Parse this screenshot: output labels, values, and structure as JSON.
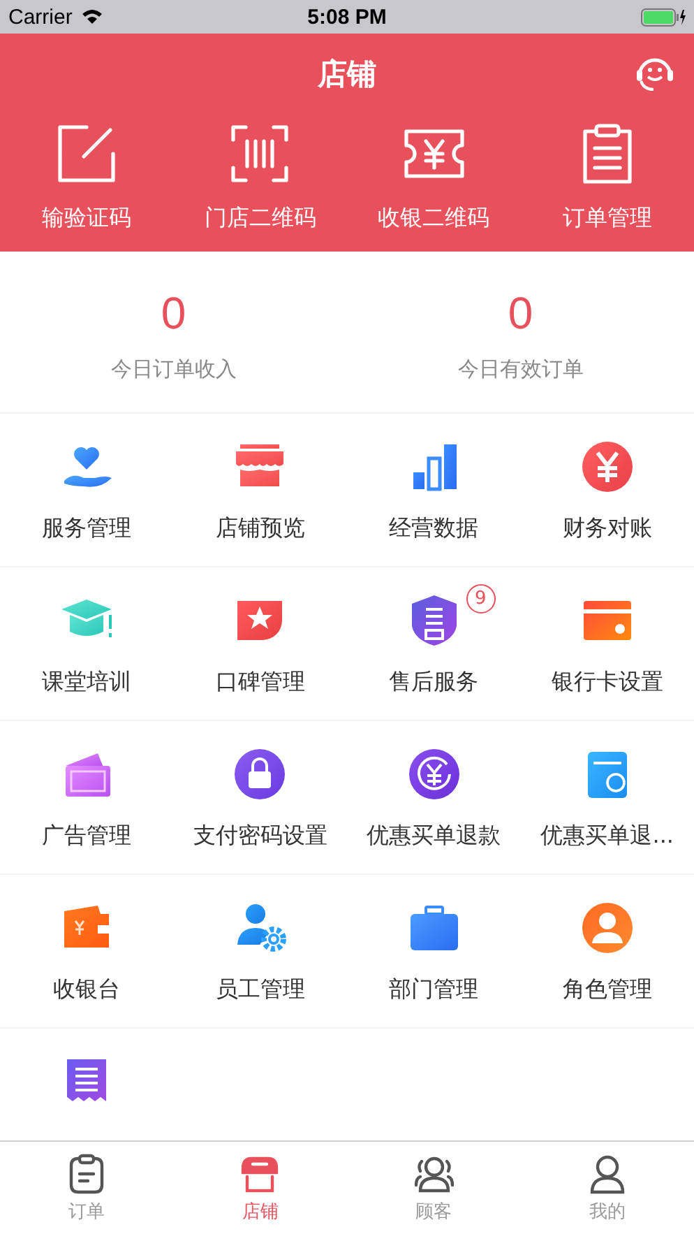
{
  "status_bar": {
    "carrier": "Carrier",
    "time": "5:08 PM"
  },
  "header": {
    "title": "店铺"
  },
  "quick_actions": [
    {
      "label": "输验证码"
    },
    {
      "label": "门店二维码"
    },
    {
      "label": "收银二维码"
    },
    {
      "label": "订单管理"
    }
  ],
  "stats": [
    {
      "value": "0",
      "label": "今日订单收入"
    },
    {
      "value": "0",
      "label": "今日有效订单"
    }
  ],
  "grid_rows": [
    {
      "items": [
        {
          "label": "服务管理"
        },
        {
          "label": "店铺预览"
        },
        {
          "label": "经营数据"
        },
        {
          "label": "财务对账"
        }
      ]
    },
    {
      "items": [
        {
          "label": "课堂培训"
        },
        {
          "label": "口碑管理"
        },
        {
          "label": "售后服务",
          "badge": "9"
        },
        {
          "label": "银行卡设置"
        }
      ]
    },
    {
      "items": [
        {
          "label": "广告管理"
        },
        {
          "label": "支付密码设置"
        },
        {
          "label": "优惠买单退款"
        },
        {
          "label": "优惠买单退..."
        }
      ]
    },
    {
      "items": [
        {
          "label": "收银台"
        },
        {
          "label": "员工管理"
        },
        {
          "label": "部门管理"
        },
        {
          "label": "角色管理"
        }
      ]
    }
  ],
  "tabs": [
    {
      "label": "订单",
      "selected": false
    },
    {
      "label": "店铺",
      "selected": true
    },
    {
      "label": "顾客",
      "selected": false
    },
    {
      "label": "我的",
      "selected": false
    }
  ]
}
